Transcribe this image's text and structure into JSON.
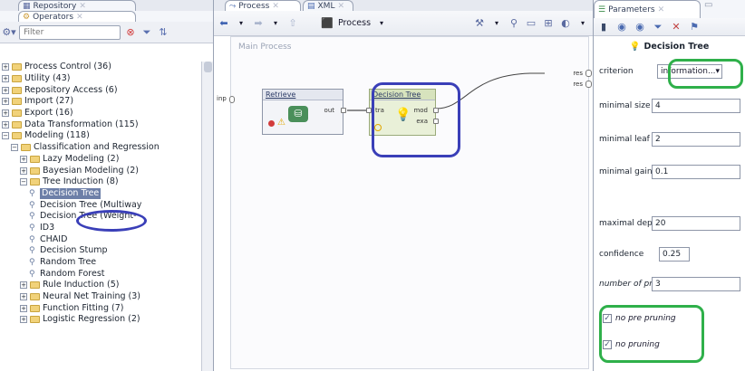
{
  "left_panel": {
    "tabs": [
      "Repository",
      "Operators"
    ],
    "filter_placeholder": "Filter",
    "tree": [
      {
        "label": "Process Control (36)",
        "level": 0,
        "type": "folder",
        "expanded": false
      },
      {
        "label": "Utility (43)",
        "level": 0,
        "type": "folder",
        "expanded": false
      },
      {
        "label": "Repository Access (6)",
        "level": 0,
        "type": "folder",
        "expanded": false
      },
      {
        "label": "Import (27)",
        "level": 0,
        "type": "folder",
        "expanded": false
      },
      {
        "label": "Export (16)",
        "level": 0,
        "type": "folder",
        "expanded": false
      },
      {
        "label": "Data Transformation (115)",
        "level": 0,
        "type": "folder",
        "expanded": false
      },
      {
        "label": "Modeling (118)",
        "level": 0,
        "type": "folder",
        "expanded": true
      },
      {
        "label": "Classification and Regression",
        "level": 1,
        "type": "folder",
        "expanded": true
      },
      {
        "label": "Lazy Modeling (2)",
        "level": 2,
        "type": "folder",
        "expanded": false
      },
      {
        "label": "Bayesian Modeling (2)",
        "level": 2,
        "type": "folder",
        "expanded": false
      },
      {
        "label": "Tree Induction (8)",
        "level": 2,
        "type": "folder",
        "expanded": true
      },
      {
        "label": "Decision Tree",
        "level": 3,
        "type": "operator",
        "selected": true
      },
      {
        "label": "Decision Tree (Multiway",
        "level": 3,
        "type": "operator"
      },
      {
        "label": "Decision Tree (Weight-",
        "level": 3,
        "type": "operator"
      },
      {
        "label": "ID3",
        "level": 3,
        "type": "operator"
      },
      {
        "label": "CHAID",
        "level": 3,
        "type": "operator"
      },
      {
        "label": "Decision Stump",
        "level": 3,
        "type": "operator"
      },
      {
        "label": "Random Tree",
        "level": 3,
        "type": "operator"
      },
      {
        "label": "Random Forest",
        "level": 3,
        "type": "operator"
      },
      {
        "label": "Rule Induction (5)",
        "level": 2,
        "type": "folder",
        "expanded": false
      },
      {
        "label": "Neural Net Training (3)",
        "level": 2,
        "type": "folder",
        "expanded": false
      },
      {
        "label": "Function Fitting (7)",
        "level": 2,
        "type": "folder",
        "expanded": false
      },
      {
        "label": "Logistic Regression (2)",
        "level": 2,
        "type": "folder",
        "expanded": false
      }
    ]
  },
  "center_panel": {
    "tabs": [
      "Process",
      "XML"
    ],
    "process_button": "Process",
    "canvas_title": "Main Process",
    "operators": [
      {
        "name": "Retrieve",
        "ports_out": [
          "out"
        ]
      },
      {
        "name": "Decision Tree",
        "ports_in": [
          "tra"
        ],
        "ports_out": [
          "mod",
          "exa"
        ]
      }
    ],
    "result_ports": [
      "res",
      "res"
    ],
    "input_port": "inp"
  },
  "right_panel": {
    "tab": "Parameters",
    "operator_title": "Decision Tree",
    "params": [
      {
        "label": "criterion",
        "value": "information...",
        "kind": "select"
      },
      {
        "label": "minimal size f...",
        "value": "4",
        "kind": "text"
      },
      {
        "label": "minimal leaf ...",
        "value": "2",
        "kind": "text"
      },
      {
        "label": "minimal gain",
        "value": "0.1",
        "kind": "text"
      },
      {
        "label": "maximal depth",
        "value": "20",
        "kind": "text"
      },
      {
        "label": "confidence",
        "value": "0.25",
        "kind": "text"
      },
      {
        "label": "number of pr...",
        "value": "3",
        "kind": "text"
      }
    ],
    "checkboxes": [
      {
        "label": "no pre pruning",
        "checked": true
      },
      {
        "label": "no pruning",
        "checked": true
      }
    ]
  },
  "colors": {
    "highlight_blue": "#3a3fb8",
    "highlight_green": "#2fb04a",
    "selection": "#6d7fa8",
    "operator_bg": "#e9f0d8"
  }
}
